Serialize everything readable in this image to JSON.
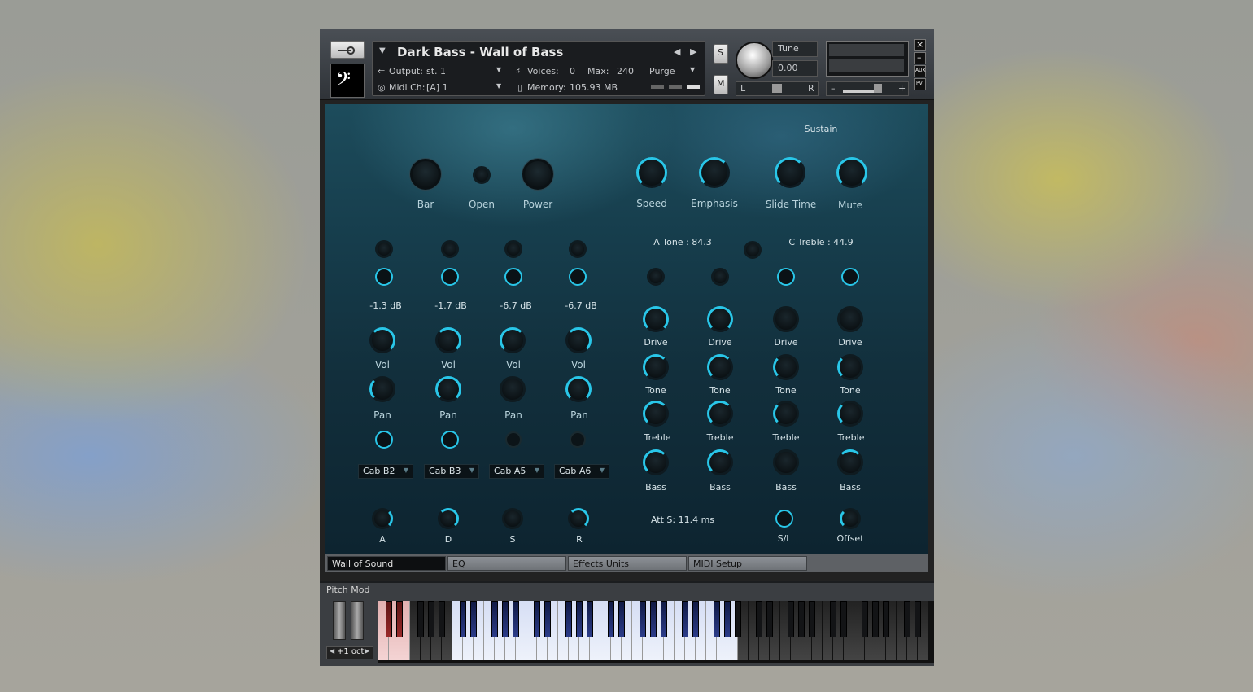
{
  "instrument": {
    "name": "Dark Bass - Wall of Bass",
    "output_label": "Output:",
    "output_value": "st. 1",
    "midi_label": "Midi Ch:",
    "midi_value": "[A] 1",
    "voices_label": "Voices:",
    "voices_value": "0",
    "max_label": "Max:",
    "max_value": "240",
    "memory_label": "Memory:",
    "memory_value": "105.93 MB",
    "purge_label": "Purge",
    "solo_label": "S",
    "mute_label": "M",
    "tune_label": "Tune",
    "tune_value": "0.00",
    "pan_left": "L",
    "pan_right": "R",
    "close_glyph": "×",
    "minimize_glyph": "–",
    "aux_label": "AUX",
    "pv_label": "PV",
    "vol_minus": "–",
    "vol_plus": "+"
  },
  "top_controls": {
    "sustain_label": "Sustain",
    "bar": "Bar",
    "open": "Open",
    "power": "Power",
    "speed": "Speed",
    "emphasis": "Emphasis",
    "slide_time": "Slide Time",
    "mute": "Mute",
    "a_tone": "A Tone : 84.3",
    "c_treble": "C Treble : 44.9"
  },
  "channels": [
    {
      "db": "-1.3 dB",
      "vol": "Vol",
      "pan": "Pan",
      "cab": "Cab B2"
    },
    {
      "db": "-1.7 dB",
      "vol": "Vol",
      "pan": "Pan",
      "cab": "Cab B3"
    },
    {
      "db": "-6.7 dB",
      "vol": "Vol",
      "pan": "Pan",
      "cab": "Cab A5"
    },
    {
      "db": "-6.7 dB",
      "vol": "Vol",
      "pan": "Pan",
      "cab": "Cab A6"
    }
  ],
  "amps": [
    {
      "drive": "Drive",
      "tone": "Tone",
      "treble": "Treble",
      "bass": "Bass"
    },
    {
      "drive": "Drive",
      "tone": "Tone",
      "treble": "Treble",
      "bass": "Bass"
    },
    {
      "drive": "Drive",
      "tone": "Tone",
      "treble": "Treble",
      "bass": "Bass"
    },
    {
      "drive": "Drive",
      "tone": "Tone",
      "treble": "Treble",
      "bass": "Bass"
    }
  ],
  "envelope": {
    "a": "A",
    "d": "D",
    "s": "S",
    "r": "R"
  },
  "bottom_right": {
    "att": "Att S:  11.4 ms",
    "sl": "S/L",
    "offset": "Offset"
  },
  "tabs": [
    "Wall of Sound",
    "EQ",
    "Effects Units",
    "MIDI Setup"
  ],
  "keyboard": {
    "pitch_mod_label": "Pitch Mod",
    "octave_label": "+1 oct"
  },
  "colors": {
    "accent": "#29c6e8",
    "panel_bg": "#163d4c"
  }
}
